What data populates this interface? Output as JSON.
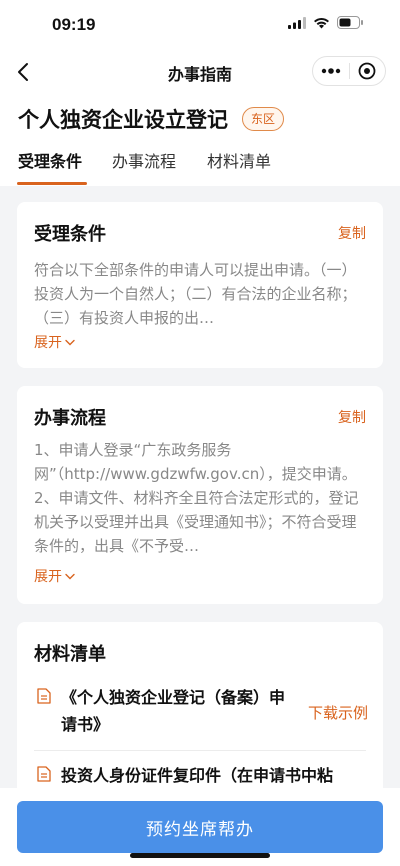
{
  "status_bar": {
    "time": "09:19",
    "icons": [
      "signal-icon",
      "wifi-icon",
      "battery-icon"
    ]
  },
  "nav": {
    "title": "办事指南",
    "back_icon": "chevron-left-icon",
    "more_icon": "more-dots-icon",
    "close_icon": "target-close-icon"
  },
  "header": {
    "title": "个人独资企业设立登记",
    "badge": "东区",
    "tabs": [
      {
        "label": "受理条件",
        "active": true
      },
      {
        "label": "办事流程",
        "active": false
      },
      {
        "label": "材料清单",
        "active": false
      }
    ]
  },
  "conditions": {
    "title": "受理条件",
    "copy_label": "复制",
    "text": "符合以下全部条件的申请人可以提出申请。（一）投资人为一个自然人；（二）有合法的企业名称；（三）有投资人申报的出…",
    "expand_label": "展开"
  },
  "process": {
    "title": "办事流程",
    "copy_label": "复制",
    "text": "1、申请人登录“广东政务服务网”（http://www.gdzwfw.gov.cn），提交申请。2、申请文件、材料齐全且符合法定形式的，登记机关予以受理并出具《受理通知书》；不符合受理条件的，出具《不予受…",
    "expand_label": "展开"
  },
  "materials": {
    "title": "材料清单",
    "items": [
      {
        "name": "《个人独资企业登记（备案）申请书》",
        "action": "下载示例"
      },
      {
        "name": "投资人身份证件复印件（在申请书中粘",
        "action": ""
      }
    ]
  },
  "bottom": {
    "button_label": "预约坐席帮办"
  },
  "colors": {
    "accent": "#d9631e",
    "primary": "#4a90e8",
    "background": "#f3f4f6"
  }
}
